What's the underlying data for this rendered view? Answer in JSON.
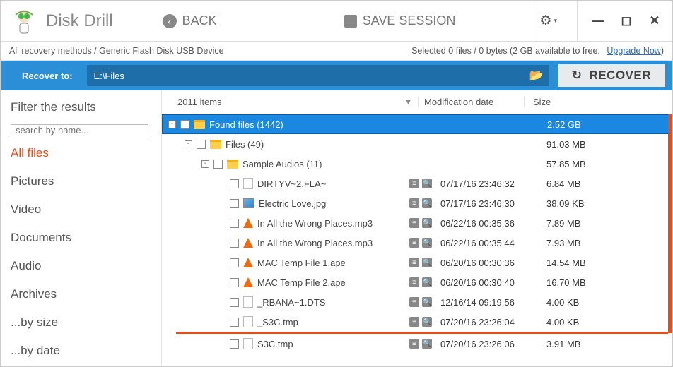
{
  "app": {
    "title": "Disk Drill"
  },
  "topbar": {
    "back": "BACK",
    "save": "SAVE SESSION"
  },
  "crumb": {
    "path": "All recovery methods / Generic Flash Disk USB Device",
    "selected": "Selected 0 files / 0 bytes (2 GB available to free.",
    "upgrade": "Upgrade Now",
    "paren": ")"
  },
  "recover": {
    "label": "Recover to:",
    "path": "E:\\Files",
    "button": "RECOVER"
  },
  "sidebar": {
    "heading": "Filter the results",
    "search_ph": "search by name...",
    "filters": [
      "All files",
      "Pictures",
      "Video",
      "Documents",
      "Audio",
      "Archives",
      "...by size",
      "...by date"
    ]
  },
  "table": {
    "count_label": "2011 items",
    "col_date": "Modification date",
    "col_size": "Size",
    "folders": [
      {
        "indent": 0,
        "toggle": "-",
        "label": "Found files (1442)",
        "size": "2.52 GB",
        "selected": true
      },
      {
        "indent": 1,
        "toggle": "-",
        "label": "Files (49)",
        "size": "91.03 MB"
      },
      {
        "indent": 2,
        "toggle": "-",
        "label": "Sample Audios (11)",
        "size": "57.85 MB"
      }
    ],
    "files": [
      {
        "icon": "file",
        "name": "DIRTYV~2.FLA~",
        "date": "07/17/16 23:46:32",
        "size": "6.84 MB"
      },
      {
        "icon": "img",
        "name": "Electric Love.jpg",
        "date": "07/17/16 23:46:30",
        "size": "38.09 KB"
      },
      {
        "icon": "vlc",
        "name": "In All the Wrong Places.mp3",
        "date": "06/22/16 00:35:36",
        "size": "7.89 MB"
      },
      {
        "icon": "vlc",
        "name": "In All the Wrong Places.mp3",
        "date": "06/22/16 00:35:44",
        "size": "7.93 MB"
      },
      {
        "icon": "vlc",
        "name": "MAC Temp File 1.ape",
        "date": "06/20/16 00:30:36",
        "size": "14.54 MB"
      },
      {
        "icon": "vlc",
        "name": "MAC Temp File 2.ape",
        "date": "06/20/16 00:30:40",
        "size": "16.70 MB"
      },
      {
        "icon": "file",
        "name": "_RBANA~1.DTS",
        "date": "12/16/14 09:19:56",
        "size": "4.00 KB"
      },
      {
        "icon": "file",
        "name": "_S3C.tmp",
        "date": "07/20/16 23:26:04",
        "size": "4.00 KB"
      },
      {
        "icon": "file",
        "name": "S3C.tmp",
        "date": "07/20/16 23:26:06",
        "size": "3.91 MB"
      }
    ]
  }
}
